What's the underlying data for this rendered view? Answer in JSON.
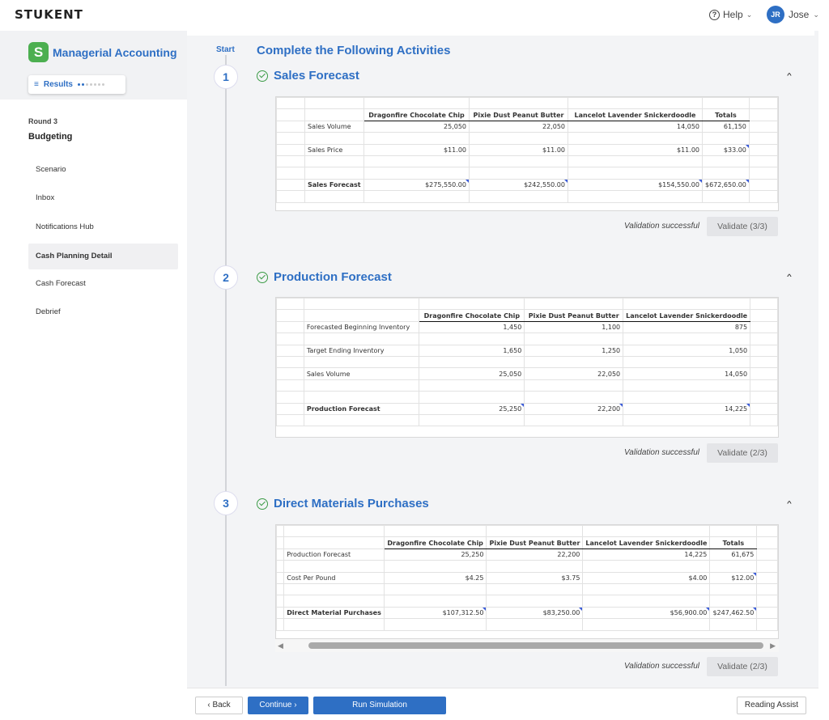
{
  "header": {
    "logo": "STUKENT",
    "help_label": "Help",
    "user_initials": "JR",
    "user_name": "Jose"
  },
  "sidebar": {
    "course_title": "Managerial Accounting",
    "brand_letter": "S",
    "results_label": "Results",
    "round_label": "Round 3",
    "section_label": "Budgeting",
    "items": [
      {
        "label": "Scenario"
      },
      {
        "label": "Inbox"
      },
      {
        "label": "Notifications Hub"
      },
      {
        "label": "Cash Planning Detail"
      },
      {
        "label": "Cash Forecast"
      },
      {
        "label": "Debrief"
      }
    ],
    "active_item": "Cash Planning Detail"
  },
  "main": {
    "start_label": "Start",
    "page_title": "Complete the Following Activities",
    "sections": [
      {
        "number": "1",
        "title": "Sales Forecast",
        "validation_text": "Validation successful",
        "validate_label": "Validate (3/3)",
        "columns": [
          "Dragonfire Chocolate Chip",
          "Pixie Dust Peanut Butter",
          "Lancelot Lavender Snickerdoodle",
          "Totals"
        ],
        "rows": [
          {
            "label": "Sales Volume",
            "values": [
              "25,050",
              "22,050",
              "14,050",
              "61,150"
            ]
          },
          {
            "label": "Sales Price",
            "values": [
              "$11.00",
              "$11.00",
              "$11.00",
              "$33.00"
            ]
          },
          {
            "label": "Sales Forecast",
            "values": [
              "$275,550.00",
              "$242,550.00",
              "$154,550.00",
              "$672,650.00"
            ]
          }
        ]
      },
      {
        "number": "2",
        "title": "Production Forecast",
        "validation_text": "Validation successful",
        "validate_label": "Validate (2/3)",
        "columns": [
          "Dragonfire Chocolate Chip",
          "Pixie Dust Peanut Butter",
          "Lancelot Lavender Snickerdoodle"
        ],
        "rows": [
          {
            "label": "Forecasted Beginning Inventory",
            "values": [
              "1,450",
              "1,100",
              "875"
            ]
          },
          {
            "label": "Target Ending Inventory",
            "values": [
              "1,650",
              "1,250",
              "1,050"
            ]
          },
          {
            "label": "Sales Volume",
            "values": [
              "25,050",
              "22,050",
              "14,050"
            ]
          },
          {
            "label": "Production Forecast",
            "values": [
              "25,250",
              "22,200",
              "14,225"
            ]
          }
        ]
      },
      {
        "number": "3",
        "title": "Direct Materials Purchases",
        "validation_text": "Validation successful",
        "validate_label": "Validate (2/3)",
        "columns": [
          "Dragonfire Chocolate Chip",
          "Pixie Dust Peanut Butter",
          "Lancelot Lavender Snickerdoodle",
          "Totals"
        ],
        "rows": [
          {
            "label": "Production Forecast",
            "values": [
              "25,250",
              "22,200",
              "14,225",
              "61,675"
            ]
          },
          {
            "label": "Cost Per Pound",
            "values": [
              "$4.25",
              "$3.75",
              "$4.00",
              "$12.00"
            ]
          },
          {
            "label": "Direct Material Purchases",
            "values": [
              "$107,312.50",
              "$83,250.00",
              "$56,900.00",
              "$247,462.50"
            ]
          }
        ]
      }
    ]
  },
  "footer": {
    "back_label": "Back",
    "continue_label": "Continue",
    "run_label": "Run Simulation",
    "reading_label": "Reading Assist"
  },
  "colors": {
    "accent": "#2e6fc4",
    "success": "#3b9b46",
    "brand": "#4caf50"
  }
}
